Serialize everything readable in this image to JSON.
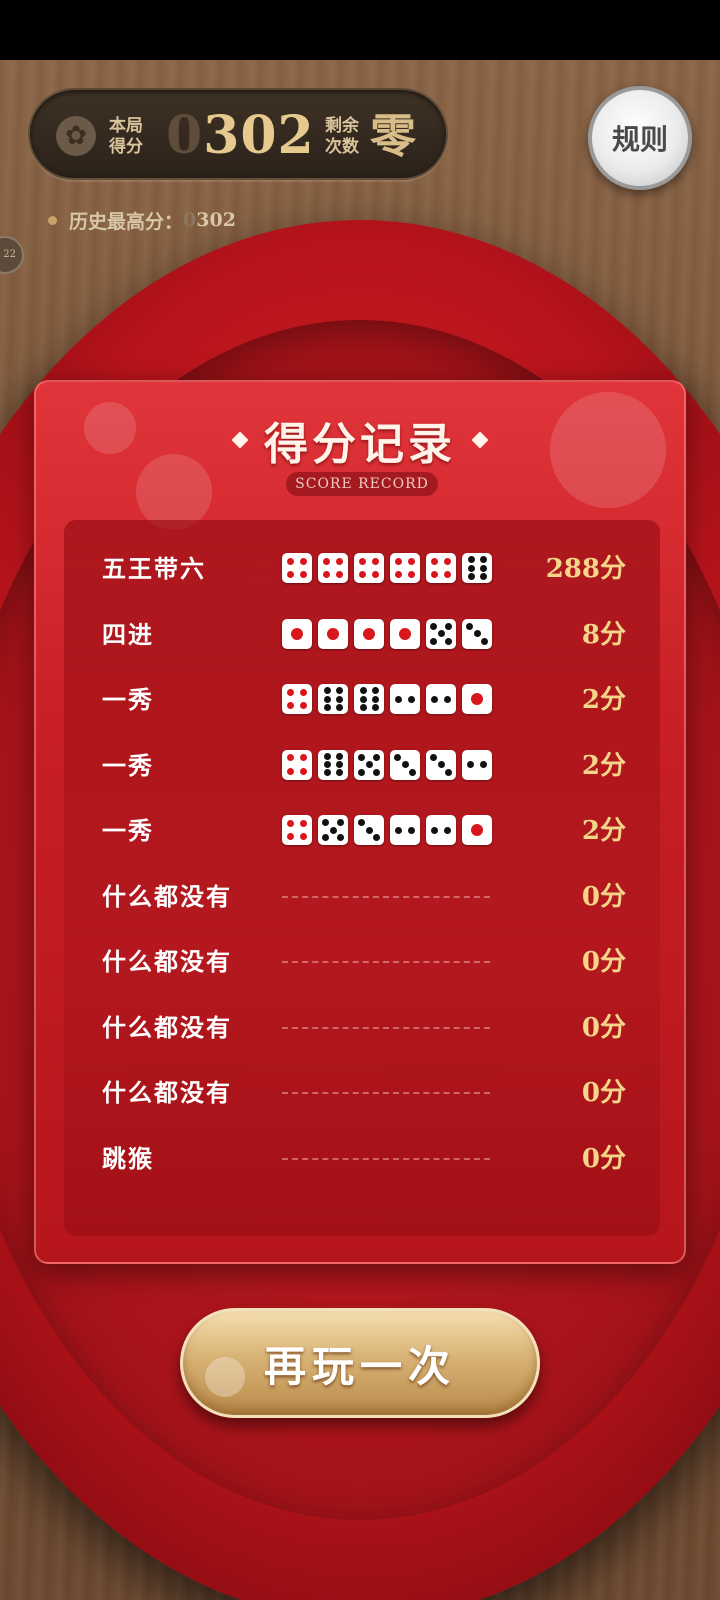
{
  "header": {
    "score_label_line1": "本局",
    "score_label_line2": "得分",
    "score_dim": "0",
    "score_lit": "302",
    "remain_label_line1": "剩余",
    "remain_label_line2": "次数",
    "remain_value": "零",
    "rules_label": "规则",
    "history_label": "历史最高分：",
    "history_dim": "0",
    "history_lit": "302",
    "side_chip_text": "22"
  },
  "panel": {
    "title": "得分记录",
    "subtitle": "SCORE RECORD",
    "rows": [
      {
        "name": "五王带六",
        "dice": [
          4,
          4,
          4,
          4,
          4,
          6
        ],
        "score": "288分"
      },
      {
        "name": "四进",
        "dice": [
          1,
          1,
          1,
          1,
          5,
          3
        ],
        "score": "8分"
      },
      {
        "name": "一秀",
        "dice": [
          4,
          6,
          6,
          2,
          2,
          1
        ],
        "score": "2分"
      },
      {
        "name": "一秀",
        "dice": [
          4,
          6,
          5,
          3,
          3,
          2
        ],
        "score": "2分"
      },
      {
        "name": "一秀",
        "dice": [
          4,
          5,
          3,
          2,
          2,
          1
        ],
        "score": "2分"
      },
      {
        "name": "什么都没有",
        "dice": [],
        "score": "0分"
      },
      {
        "name": "什么都没有",
        "dice": [],
        "score": "0分"
      },
      {
        "name": "什么都没有",
        "dice": [],
        "score": "0分"
      },
      {
        "name": "什么都没有",
        "dice": [],
        "score": "0分"
      },
      {
        "name": "跳猴",
        "dice": [],
        "score": "0分"
      }
    ]
  },
  "play_again_label": "再玩一次",
  "colors": {
    "accent_gold": "#f5d58a",
    "panel_red": "#c71f25",
    "die_red_pip": "#d9161c"
  }
}
